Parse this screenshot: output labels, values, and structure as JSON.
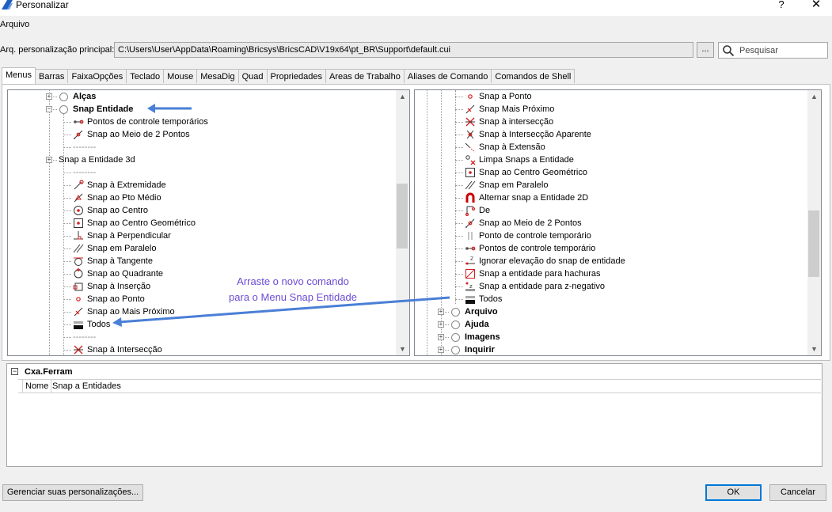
{
  "window": {
    "title": "Personalizar",
    "help": "?",
    "close": "✕"
  },
  "menubar": {
    "file": "Arquivo"
  },
  "main_file": {
    "label": "Arq. personalização principal:",
    "path": "C:\\Users\\User\\AppData\\Roaming\\Bricsys\\BricsCAD\\V19x64\\pt_BR\\Support\\default.cui",
    "browse": "..."
  },
  "search": {
    "placeholder": "Pesquisar"
  },
  "tabs": [
    "Menus",
    "Barras",
    "FaixaOpções",
    "Teclado",
    "Mouse",
    "MesaDig",
    "Quad",
    "Propriedades",
    "Areas de Trabalho",
    "Aliases de Comando",
    "Comandos de Shell"
  ],
  "active_tab": "Menus",
  "left_tree": [
    {
      "label": "Alças",
      "bold": true,
      "expander": "+",
      "radio": true
    },
    {
      "label": "Snap Entidade",
      "bold": true,
      "expander": "-",
      "radio": true
    },
    {
      "label": "Pontos de controle temporários",
      "icon": "temp-tracking-icon"
    },
    {
      "label": "Snap ao Meio de 2 Pontos",
      "icon": "midpoint-between-icon"
    },
    {
      "label": "--------",
      "sep": true
    },
    {
      "label": "Snap a Entidade 3d",
      "expander": "+"
    },
    {
      "label": "--------",
      "sep": true
    },
    {
      "label": "Snap à Extremidade",
      "icon": "endpoint-snap-icon"
    },
    {
      "label": "Snap ao Pto Médio",
      "icon": "midpoint-snap-icon"
    },
    {
      "label": "Snap ao Centro",
      "icon": "center-snap-icon"
    },
    {
      "label": "Snap ao Centro Geométrico",
      "icon": "geometric-center-icon"
    },
    {
      "label": "Snap à Perpendicular",
      "icon": "perpendicular-snap-icon"
    },
    {
      "label": "Snap em Paralelo",
      "icon": "parallel-snap-icon"
    },
    {
      "label": "Snap à Tangente",
      "icon": "tangent-snap-icon"
    },
    {
      "label": "Snap ao Quadrante",
      "icon": "quadrant-snap-icon"
    },
    {
      "label": "Snap à Inserção",
      "icon": "insertion-snap-icon"
    },
    {
      "label": "Snap ao Ponto",
      "icon": "node-snap-icon"
    },
    {
      "label": "Snap ao Mais Próximo",
      "icon": "nearest-snap-icon"
    },
    {
      "label": "Todos",
      "icon": "all-snaps-icon"
    },
    {
      "label": "--------",
      "sep": true
    },
    {
      "label": "Snap à Intersecção",
      "icon": "intersection-snap-icon"
    }
  ],
  "right_tree": [
    {
      "label": "Snap a Ponto",
      "icon": "node-snap-icon"
    },
    {
      "label": "Snap Mais Próximo",
      "icon": "nearest-snap-icon"
    },
    {
      "label": "Snap à intersecção",
      "icon": "intersection-snap-icon"
    },
    {
      "label": "Snap à Intersecção Aparente",
      "icon": "apparent-intersection-icon"
    },
    {
      "label": "Snap à Extensão",
      "icon": "extension-snap-icon"
    },
    {
      "label": "Limpa Snaps a Entidade",
      "icon": "clear-snaps-icon"
    },
    {
      "label": "Snap ao Centro Geométrico",
      "icon": "geometric-center-icon"
    },
    {
      "label": "Snap em Paralelo",
      "icon": "parallel-snap-icon"
    },
    {
      "label": "Alternar snap a Entidade 2D",
      "icon": "magnet-icon"
    },
    {
      "label": "De",
      "icon": "from-snap-icon"
    },
    {
      "label": "Snap ao Meio de 2 Pontos",
      "icon": "midpoint-between-icon"
    },
    {
      "label": "Ponto de controle temporário",
      "icon": "temp-point-icon"
    },
    {
      "label": "Pontos de controle temporário",
      "icon": "temp-tracking-icon"
    },
    {
      "label": "Ignorar elevação do snap de entidade",
      "icon": "ignore-elevation-icon"
    },
    {
      "label": "Snap a entidade para hachuras",
      "icon": "hatch-snap-icon"
    },
    {
      "label": "Snap a entidade para z-negativo",
      "icon": "z-negative-icon"
    },
    {
      "label": "Todos",
      "icon": "all-snaps-icon"
    },
    {
      "label": "Arquivo",
      "bold": true,
      "expander": "+",
      "radio": true
    },
    {
      "label": "Ajuda",
      "bold": true,
      "expander": "+",
      "radio": true
    },
    {
      "label": "Imagens",
      "bold": true,
      "expander": "+",
      "radio": true
    },
    {
      "label": "Inquirir",
      "bold": true,
      "expander": "+",
      "radio": true
    }
  ],
  "properties": {
    "title": "Cxa.Ferram",
    "name_label": "Nome",
    "name_value": "Snap a Entidades"
  },
  "annotation": {
    "line1": "Arraste o novo comando",
    "line2": "para o Menu Snap Entidade"
  },
  "buttons": {
    "manage": "Gerenciar suas personalizações...",
    "ok": "OK",
    "cancel": "Cancelar"
  },
  "colors": {
    "arrow": "#4a7fd6",
    "annotation": "#6c4bd6",
    "snap_red": "#d42020"
  }
}
